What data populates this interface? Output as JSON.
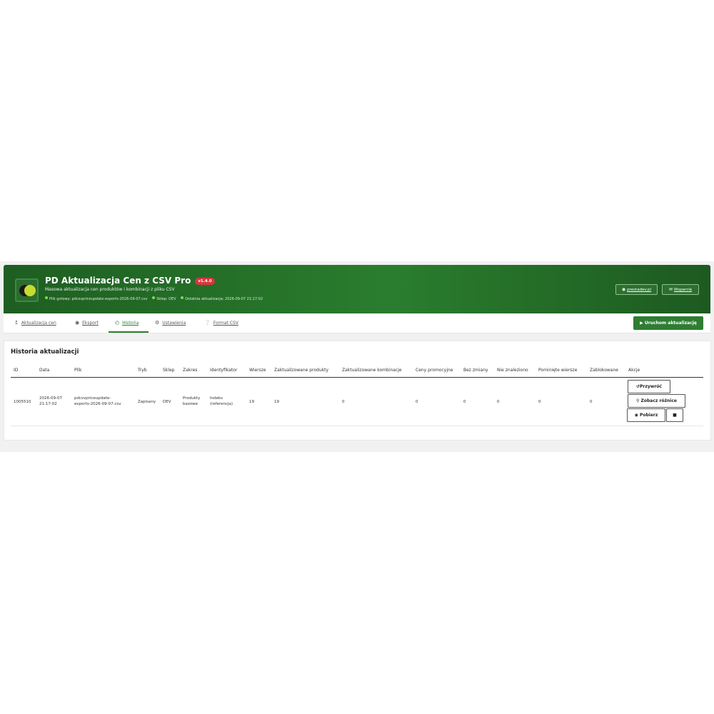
{
  "app": {
    "title": "PD Aktualizacja Cen z CSV Pro",
    "version": "v1.4.0",
    "subtitle": "Masowa aktualizacja cen produktów i kombinacji z pliku CSV",
    "status_file": "Plik gotowy: pdcsvpriceupdate-exports-2026-09-07.csv",
    "status_shop": "Sklep: DEV",
    "status_last": "Ostatnia aktualizacja: 2026-09-07 21:17:02",
    "link_site": "prestadev.pl",
    "link_support": "Wsparcie"
  },
  "tabs": [
    {
      "label": "Aktualizacja cen",
      "icon": "upload-icon"
    },
    {
      "label": "Eksport",
      "icon": "export-icon"
    },
    {
      "label": "Historia",
      "icon": "clock-icon",
      "active": true
    },
    {
      "label": "Ustawienia",
      "icon": "gears-icon"
    },
    {
      "label": "Format CSV",
      "icon": "question-icon"
    }
  ],
  "run_button": "Uruchom aktualizację",
  "history": {
    "title": "Historia aktualizacji",
    "headers": [
      "ID",
      "Data",
      "Plik",
      "Tryb",
      "Sklep",
      "Zakres",
      "Identyfikator",
      "Wiersze",
      "Zaktualizowane produkty",
      "Zaktualizowane kombinacje",
      "Ceny promocyjne",
      "Bez zmiany",
      "Nie znaleziono",
      "Pominięte wiersze",
      "Zablokowane",
      "Akcje"
    ],
    "row": {
      "id": "1005510",
      "date_line1": "2026-09-07",
      "date_line2": "21:17:02",
      "file_line1": "pdcsvpriceupdate-",
      "file_line2": "exports-2026-09-07.csv",
      "mode": "Zapisany",
      "shop": "DEV",
      "scope_line1": "Produkty",
      "scope_line2": "bazowe",
      "ident_line1": "Indeks",
      "ident_line2": "(referencja)",
      "rows": "19",
      "updated_products": "19",
      "updated_combinations": "0",
      "promo_prices": "0",
      "unchanged": "0",
      "not_found": "0",
      "skipped": "0",
      "blocked": "0"
    },
    "actions": {
      "restore": "Przywróć",
      "diff": "Zobacz różnice",
      "download": "Pobierz"
    }
  },
  "colors": {
    "header_green": "#2a7d2e",
    "accent_green": "#2e7d32",
    "version_red": "#d9363e"
  }
}
